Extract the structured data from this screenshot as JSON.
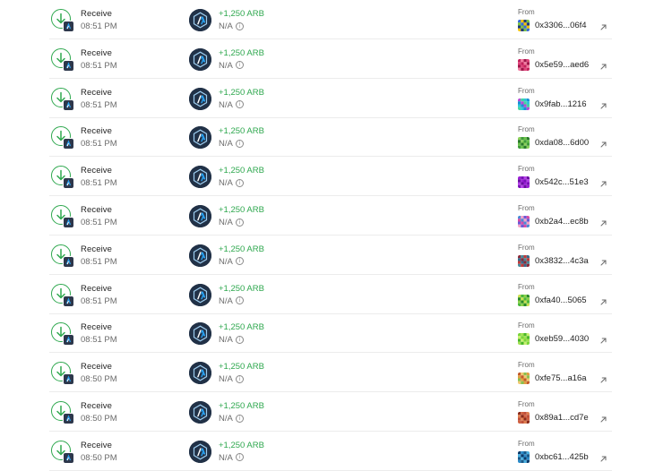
{
  "transactions": [
    {
      "type": "Receive",
      "time": "08:51 PM",
      "amount": "+1,250 ARB",
      "value": "N/A",
      "from_label": "From",
      "from_address": "0x3306...06f4",
      "avatar_colors": [
        "#3a6bd6",
        "#f2c200",
        "#1f3a7a",
        "#7ac143"
      ]
    },
    {
      "type": "Receive",
      "time": "08:51 PM",
      "amount": "+1,250 ARB",
      "value": "N/A",
      "from_label": "From",
      "from_address": "0x5e59...aed6",
      "avatar_colors": [
        "#e0437a",
        "#c2205a",
        "#f27aa0",
        "#a0164a"
      ]
    },
    {
      "type": "Receive",
      "time": "08:51 PM",
      "amount": "+1,250 ARB",
      "value": "N/A",
      "from_label": "From",
      "from_address": "0x9fab...1216",
      "avatar_colors": [
        "#2dc6d8",
        "#1a8fd6",
        "#b44cd6",
        "#42d6a0"
      ]
    },
    {
      "type": "Receive",
      "time": "08:51 PM",
      "amount": "+1,250 ARB",
      "value": "N/A",
      "from_label": "From",
      "from_address": "0xda08...6d00",
      "avatar_colors": [
        "#3f9b3a",
        "#6ac24a",
        "#2a7a2a",
        "#8ad05a"
      ]
    },
    {
      "type": "Receive",
      "time": "08:51 PM",
      "amount": "+1,250 ARB",
      "value": "N/A",
      "from_label": "From",
      "from_address": "0x542c...51e3",
      "avatar_colors": [
        "#9b1fd6",
        "#7a10b8",
        "#b440e8",
        "#6a0ea0"
      ]
    },
    {
      "type": "Receive",
      "time": "08:51 PM",
      "amount": "+1,250 ARB",
      "value": "N/A",
      "from_label": "From",
      "from_address": "0xb2a4...ec8b",
      "avatar_colors": [
        "#d64ca8",
        "#4c8ad6",
        "#f2a0c8",
        "#6a5ad6"
      ]
    },
    {
      "type": "Receive",
      "time": "08:51 PM",
      "amount": "+1,250 ARB",
      "value": "N/A",
      "from_label": "From",
      "from_address": "0x3832...4c3a",
      "avatar_colors": [
        "#c23a3a",
        "#3a6a8a",
        "#8a2a3a",
        "#4a8a9a"
      ]
    },
    {
      "type": "Receive",
      "time": "08:51 PM",
      "amount": "+1,250 ARB",
      "value": "N/A",
      "from_label": "From",
      "from_address": "0xfa40...5065",
      "avatar_colors": [
        "#4ab83a",
        "#8ad04a",
        "#2a8a2a",
        "#c8e050"
      ]
    },
    {
      "type": "Receive",
      "time": "08:51 PM",
      "amount": "+1,250 ARB",
      "value": "N/A",
      "from_label": "From",
      "from_address": "0xeb59...4030",
      "avatar_colors": [
        "#7ad63a",
        "#a0e050",
        "#4ab82a",
        "#c8f070"
      ]
    },
    {
      "type": "Receive",
      "time": "08:50 PM",
      "amount": "+1,250 ARB",
      "value": "N/A",
      "from_label": "From",
      "from_address": "0xfe75...a16a",
      "avatar_colors": [
        "#e0a040",
        "#c25a2a",
        "#f0c870",
        "#8ac050"
      ]
    },
    {
      "type": "Receive",
      "time": "08:50 PM",
      "amount": "+1,250 ARB",
      "value": "N/A",
      "from_label": "From",
      "from_address": "0x89a1...cd7e",
      "avatar_colors": [
        "#c0503a",
        "#e08050",
        "#8a2a1a",
        "#d06040"
      ]
    },
    {
      "type": "Receive",
      "time": "08:50 PM",
      "amount": "+1,250 ARB",
      "value": "N/A",
      "from_label": "From",
      "from_address": "0xbc61...425b",
      "avatar_colors": [
        "#2a8ac8",
        "#1a5a8a",
        "#4ab0e0",
        "#0a3a6a"
      ]
    }
  ],
  "colors": {
    "accent_green": "#2fa84f",
    "text_primary": "#1f1f1f",
    "text_secondary": "#6b6b6b",
    "arbitrum_navy": "#213147",
    "arbitrum_blue": "#28a0f0"
  },
  "icons": {
    "receive": "arrow-down-circle-icon",
    "chain_badge": "arbitrum-badge-icon",
    "token": "arbitrum-token-icon",
    "info": "info-icon",
    "external": "external-link-icon"
  }
}
